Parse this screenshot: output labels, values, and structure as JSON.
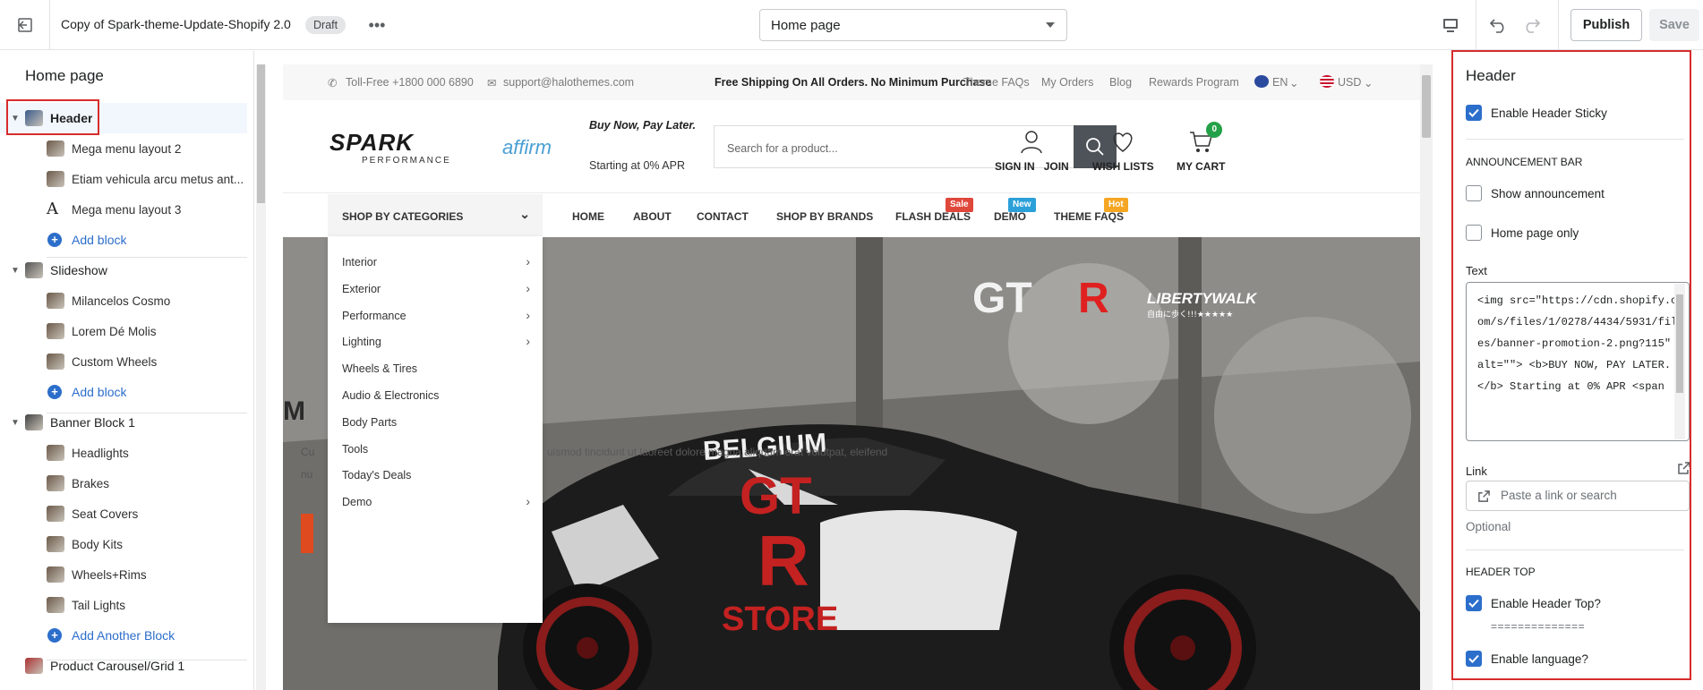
{
  "topbar": {
    "theme_name": "Copy of Spark-theme-Update-Shopify 2.0",
    "status_badge": "Draft",
    "page_selector": "Home page",
    "publish_label": "Publish",
    "save_label": "Save"
  },
  "sidebar": {
    "title": "Home page",
    "items": [
      {
        "type": "section",
        "label": "Header",
        "icon": "header-icon"
      },
      {
        "type": "block",
        "label": "Mega menu layout 2",
        "icon": "image-icon"
      },
      {
        "type": "block",
        "label": "Etiam vehicula arcu metus ant...",
        "icon": "image-icon"
      },
      {
        "type": "block",
        "label": "Mega menu layout 3",
        "icon": "text-icon"
      },
      {
        "type": "add",
        "label": "Add block"
      },
      {
        "type": "section",
        "label": "Slideshow",
        "icon": "slideshow-icon"
      },
      {
        "type": "block",
        "label": "Milancelos Cosmo",
        "icon": "image-icon"
      },
      {
        "type": "block",
        "label": "Lorem Dé Molis",
        "icon": "image-icon"
      },
      {
        "type": "block",
        "label": "Custom Wheels",
        "icon": "image-icon"
      },
      {
        "type": "add",
        "label": "Add block"
      },
      {
        "type": "section",
        "label": "Banner Block 1",
        "icon": "banner-icon"
      },
      {
        "type": "block",
        "label": "Headlights",
        "icon": "image-icon"
      },
      {
        "type": "block",
        "label": "Brakes",
        "icon": "image-icon"
      },
      {
        "type": "block",
        "label": "Seat Covers",
        "icon": "image-icon"
      },
      {
        "type": "block",
        "label": "Body Kits",
        "icon": "image-icon"
      },
      {
        "type": "block",
        "label": "Wheels+Rims",
        "icon": "image-icon"
      },
      {
        "type": "block",
        "label": "Tail Lights",
        "icon": "image-icon"
      },
      {
        "type": "add",
        "label": "Add Another Block"
      },
      {
        "type": "section",
        "label": "Product Carousel/Grid 1",
        "icon": "product-icon"
      }
    ]
  },
  "preview": {
    "topbar": {
      "phone": "Toll-Free +1800 000 6890",
      "email": "support@halothemes.com",
      "shipping": "Free Shipping On All Orders. No Minimum Purchase",
      "links": [
        "Theme FAQs",
        "My Orders",
        "Blog",
        "Rewards Program"
      ],
      "language": "EN",
      "currency": "USD"
    },
    "header": {
      "logo_text": "SPARK",
      "logo_sub": "PERFORMANCE",
      "affirm": "affirm",
      "bnpl_title": "Buy Now, Pay Later.",
      "bnpl_sub": "Starting at 0% APR",
      "search_placeholder": "Search for a product...",
      "sign_in": "SIGN IN",
      "join": "JOIN",
      "wish_lists": "WISH LISTS",
      "my_cart": "MY CART",
      "cart_count": "0"
    },
    "nav": {
      "categories_button": "SHOP BY CATEGORIES",
      "items": [
        "HOME",
        "ABOUT",
        "CONTACT",
        "SHOP BY BRANDS",
        "FLASH DEALS",
        "DEMO",
        "THEME FAQS"
      ],
      "badges": {
        "flash_deals": "Sale",
        "demo": "New",
        "theme_faqs": "Hot"
      }
    },
    "categories": [
      {
        "label": "Interior",
        "has_sub": true
      },
      {
        "label": "Exterior",
        "has_sub": true
      },
      {
        "label": "Performance",
        "has_sub": true
      },
      {
        "label": "Lighting",
        "has_sub": true
      },
      {
        "label": "Wheels & Tires",
        "has_sub": false
      },
      {
        "label": "Audio & Electronics",
        "has_sub": false
      },
      {
        "label": "Body Parts",
        "has_sub": false
      },
      {
        "label": "Tools",
        "has_sub": false
      },
      {
        "label": "Today's Deals",
        "has_sub": false
      },
      {
        "label": "Demo",
        "has_sub": true
      }
    ],
    "hero": {
      "brand_left": "GT",
      "brand_right": "R",
      "libertywalk": "LIBERTYWALK",
      "libertywalk_sub": "自由に歩く!!!★★★★★",
      "car_text_1": "BELGIUM",
      "car_text_2": "GT",
      "car_text_3": "R",
      "car_text_4": "STORE",
      "heading_partial": "M",
      "heading_partial_2": "Mi",
      "body_partial_1": "Cu",
      "body_partial_2": "nu",
      "body_partial_3": "uismod tincidunt ut laoreet dolore magna aliquam erat volutpat, eleifend"
    }
  },
  "panel": {
    "title": "Header",
    "enable_sticky": {
      "label": "Enable Header Sticky",
      "checked": true
    },
    "announcement_caption": "ANNOUNCEMENT BAR",
    "show_announcement": {
      "label": "Show announcement",
      "checked": false
    },
    "home_only": {
      "label": "Home page only",
      "checked": false
    },
    "text_label": "Text",
    "text_value": "<img src=\"https://cdn.shopify.com/s/files/1/0278/4434/5931/files/banner-promotion-2.png?115\" alt=\"\"> <b>BUY NOW, PAY LATER.</b> Starting at 0% APR <span",
    "link_label": "Link",
    "link_placeholder": "Paste a link or search",
    "optional": "Optional",
    "header_top_caption": "HEADER TOP",
    "enable_header_top": {
      "label": "Enable Header Top?",
      "checked": true
    },
    "separator_text": "==============",
    "enable_language": {
      "label": "Enable language?",
      "checked": true
    }
  },
  "colors": {
    "accent": "#2c6ecb",
    "highlight": "#d72c2c",
    "sale": "#e0473b",
    "new": "#2ba0d8",
    "hot": "#f5a623",
    "cart_badge": "#24a148"
  }
}
